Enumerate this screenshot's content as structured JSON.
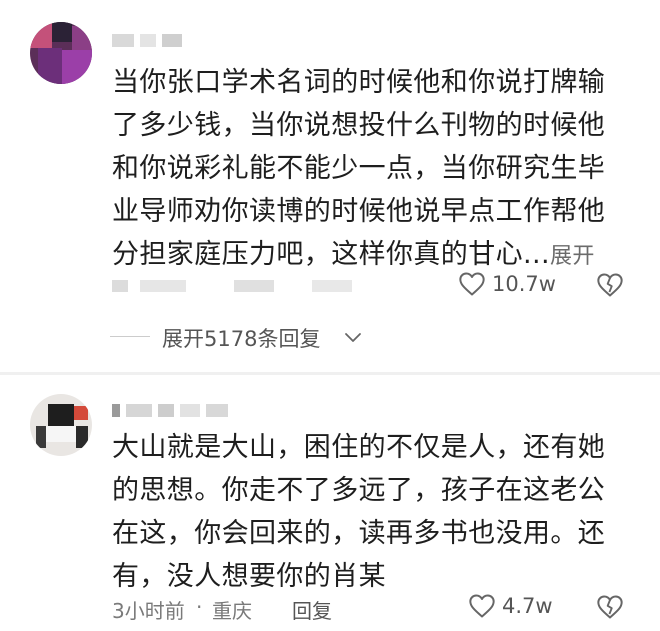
{
  "comments": [
    {
      "text": "当你张口学术名词的时候他和你说打牌输了多少钱，当你说想投什么刊物的时候他和你说彩礼能不能少一点，当你研究生毕业导师劝你读博的时候他说早点工作帮他分担家庭压力吧，这样你真的甘心...",
      "expand_label": "展开",
      "likes": "10.7w",
      "icons": {
        "like": "heart-outline-icon",
        "dislike": "broken-heart-icon"
      }
    },
    {
      "text": "大山就是大山，困住的不仅是人，还有她的思想。你走不了多远了，孩子在这老公在这，你会回来的，读再多书也没用。还有，没人想要你的肖某",
      "time": "3小时前",
      "separator": "·",
      "location": "重庆",
      "reply_label": "回复",
      "likes": "4.7w",
      "icons": {
        "like": "heart-outline-icon",
        "dislike": "broken-heart-icon"
      }
    }
  ],
  "replies_toggle": {
    "label": "展开5178条回复",
    "icon": "chevron-down-icon"
  },
  "colors": {
    "text": "#1e1e1e",
    "secondary": "#7a7a7a",
    "icon": "#666666"
  }
}
